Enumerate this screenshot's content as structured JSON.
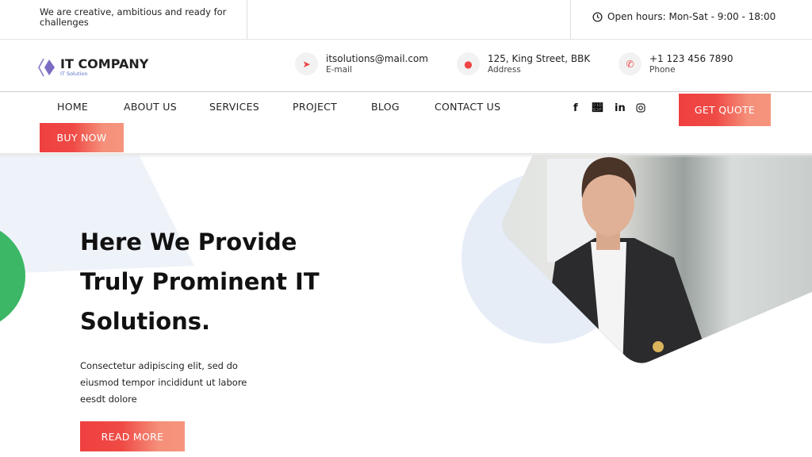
{
  "topbar": {
    "tagline": "We are creative, ambitious and ready for challenges",
    "hours": "Open hours: Mon-Sat - 9:00 - 18:00",
    "hours_icon": "clock-icon"
  },
  "logo": {
    "title": "IT COMPANY",
    "subtitle": "IT Solution"
  },
  "contacts": [
    {
      "value": "itsolutions@mail.com",
      "label": "E-mail",
      "icon": "paper-plane-icon"
    },
    {
      "value": "125, King Street, BBK",
      "label": "Address",
      "icon": "map-pin-icon"
    },
    {
      "value": "+1 123 456 7890",
      "label": "Phone",
      "icon": "phone-icon"
    }
  ],
  "nav": {
    "items": [
      "HOME",
      "ABOUT US",
      "SERVICES",
      "PROJECT",
      "BLOG",
      "CONTACT US"
    ],
    "get_quote": "GET QUOTE",
    "buy_now": "BUY NOW"
  },
  "social": [
    "facebook",
    "twitter",
    "linkedin",
    "instagram"
  ],
  "hero": {
    "title_lines": [
      "Here We Provide",
      "Truly Prominent IT",
      "Solutions."
    ],
    "text": "Consectetur adipiscing elit, sed do eiusmod tempor incididunt ut labore eesdt dolore",
    "cta": "READ MORE"
  },
  "colors": {
    "accent": "#ef4040",
    "accent_light": "#f5957c",
    "blob": "#e6edf7",
    "green": "#3cb765"
  }
}
